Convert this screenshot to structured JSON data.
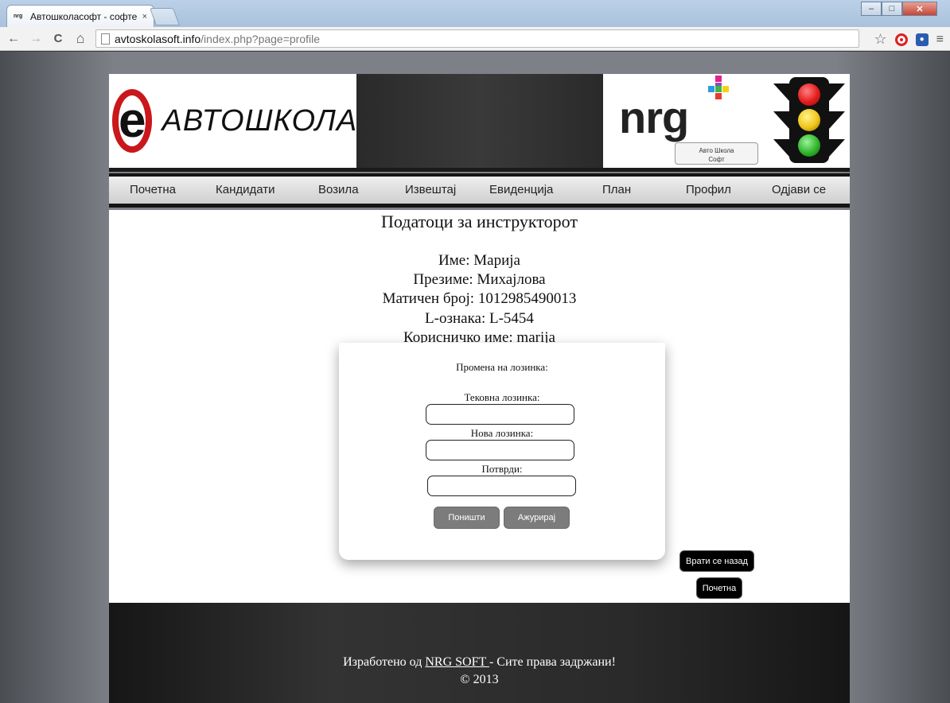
{
  "browser": {
    "tab_title": "Автошколасофт - софте",
    "tab_favicon": "nrg",
    "tab_close": "×",
    "url_host": "avtoskolasoft.info",
    "url_path": "/index.php?page=profile",
    "window_controls": {
      "minimize": "–",
      "maximize": "□",
      "close": "✕"
    },
    "nav_icons": {
      "back": "←",
      "forward": "→",
      "reload": "C",
      "home": "⌂"
    },
    "star": "☆",
    "menu": "≡"
  },
  "header": {
    "logo_letter": "e",
    "logo_text": "АВТОШКОЛА",
    "brand_text": "nrg",
    "badge_line1": "Авто Школа",
    "badge_line2": "Софт",
    "colors": {
      "logo_ring": "#c9171c",
      "red_light": "#e41b1b",
      "yellow_light": "#f0c51a",
      "green_light": "#2fb52c"
    }
  },
  "nav": {
    "items": [
      {
        "label": "Почетна"
      },
      {
        "label": "Кандидати"
      },
      {
        "label": "Возила"
      },
      {
        "label": "Извештај"
      },
      {
        "label": "Евиденција"
      },
      {
        "label": "План"
      },
      {
        "label": "Профил"
      },
      {
        "label": "Одјави се"
      }
    ]
  },
  "profile": {
    "title": "Податоци за инструкторот",
    "first_name": "Име: Марија",
    "last_name": "Презиме: Михајлова",
    "id_number": "Матичен број: 1012985490013",
    "l_mark": "L-ознака: L-5454",
    "username": "Корисничко име: marija"
  },
  "password_form": {
    "heading": "Промена на лозинка:",
    "current_label": "Тековна лозинка:",
    "current_value": "",
    "new_label": "Нова лозинка:",
    "new_value": "",
    "confirm_label": "Потврди:",
    "confirm_value": "",
    "cancel_button": "Поништи",
    "update_button": "Ажурирај"
  },
  "side_buttons": {
    "back": "Врати се назад",
    "home": "Почетна"
  },
  "footer": {
    "prefix": "Изработено од ",
    "link": "NRG SOFT ",
    "suffix": "- Сите права задржани!",
    "copyright": "© 2013"
  }
}
